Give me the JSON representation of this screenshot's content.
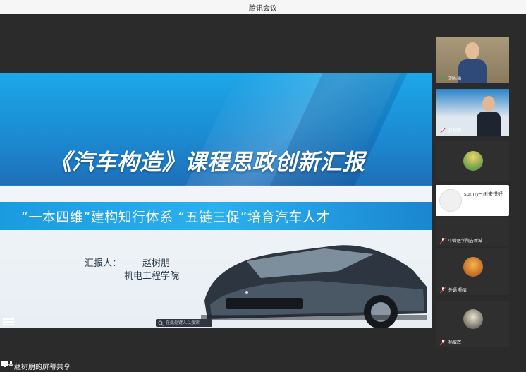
{
  "window": {
    "title": "腾讯会议"
  },
  "slide": {
    "title": "《汽车构造》课程思政创新汇报",
    "banner": "“一本四维”建构知行体系  “五链三促”培育汽车人才",
    "reporter_label": "汇报人：",
    "reporter_name": "赵树朋",
    "department": "机电工程学院",
    "search_placeholder": "在此处键入以搜索"
  },
  "share_bar": {
    "label": "赵树朋的屏幕共享"
  },
  "participants": [
    {
      "name": "刘永福",
      "type": "video",
      "speaking": true
    },
    {
      "name": "赵树朋",
      "type": "video",
      "speaking": false
    },
    {
      "name": "",
      "type": "avatar",
      "speaking": false
    },
    {
      "name": "sunny~树来悦好",
      "type": "namecard",
      "speaking": false
    },
    {
      "name": "中兽医学院吉新城",
      "type": "avatar",
      "speaking": false
    },
    {
      "name": "外语 杨洁",
      "type": "avatar",
      "speaking": false
    },
    {
      "name": "杨敏辉",
      "type": "avatar",
      "speaking": false
    }
  ],
  "colors": {
    "accent_green": "#27b24a",
    "slide_blue": "#1b8fd6",
    "background": "#2b2b2b"
  }
}
